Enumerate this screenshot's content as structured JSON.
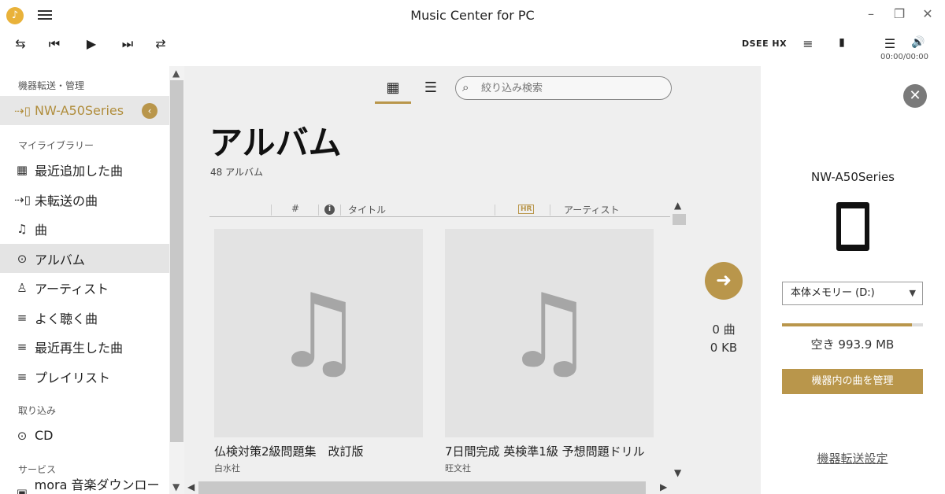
{
  "window": {
    "title": "Music Center for PC",
    "minimize_icon": "–",
    "restore_icon": "❐",
    "close_icon": "✕"
  },
  "player": {
    "repeat_icon": "⇆",
    "prev_icon": "⏮",
    "play_icon": "▶",
    "next_icon": "⏭",
    "shuffle_icon": "⇄",
    "dsee_label": "DSEE HX",
    "equalizer_icon": "≡",
    "queue_icon": "☰",
    "volume_icon": "🔊",
    "time": "00:00/00:00"
  },
  "sidebar": {
    "device_section": "機器転送・管理",
    "device_name": "NW-A50Series",
    "library_section": "マイライブラリー",
    "library_items": [
      {
        "label": "最近追加した曲",
        "icon": "▦"
      },
      {
        "label": "未転送の曲",
        "icon": "⇢▯"
      },
      {
        "label": "曲",
        "icon": "♫"
      },
      {
        "label": "アルバム",
        "icon": "⊙"
      },
      {
        "label": "アーティスト",
        "icon": "♙"
      },
      {
        "label": "よく聴く曲",
        "icon": "≡"
      },
      {
        "label": "最近再生した曲",
        "icon": "≡"
      },
      {
        "label": "プレイリスト",
        "icon": "≡"
      }
    ],
    "import_section": "取り込み",
    "import_items": [
      {
        "label": "CD",
        "icon": "⊙"
      }
    ],
    "services_section": "サービス",
    "services_items": [
      {
        "label": "mora 音楽ダウンロード",
        "icon": "▣"
      }
    ]
  },
  "main": {
    "search_placeholder": "絞り込み検索",
    "heading": "アルバム",
    "count": "48 アルバム",
    "columns": {
      "number": "#",
      "info": "i",
      "title": "タイトル",
      "hr": "HR",
      "artist": "アーティスト"
    },
    "albums": [
      {
        "title": "仏検対策2級問題集　改訂版",
        "publisher": "白水社"
      },
      {
        "title": "7日間完成 英検準1級 予想問題ドリル",
        "publisher": "旺文社"
      }
    ]
  },
  "transfer": {
    "songs": "0 曲",
    "size": "0 KB"
  },
  "device_panel": {
    "name": "NW-A50Series",
    "storage_select": "本体メモリー (D:)",
    "storage_used_fraction": 0.92,
    "free_space": "空き 993.9 MB",
    "manage_button": "機器内の曲を管理",
    "transfer_settings": "機器転送設定"
  },
  "colors": {
    "accent": "#b9964b",
    "content_bg": "#efefef"
  }
}
